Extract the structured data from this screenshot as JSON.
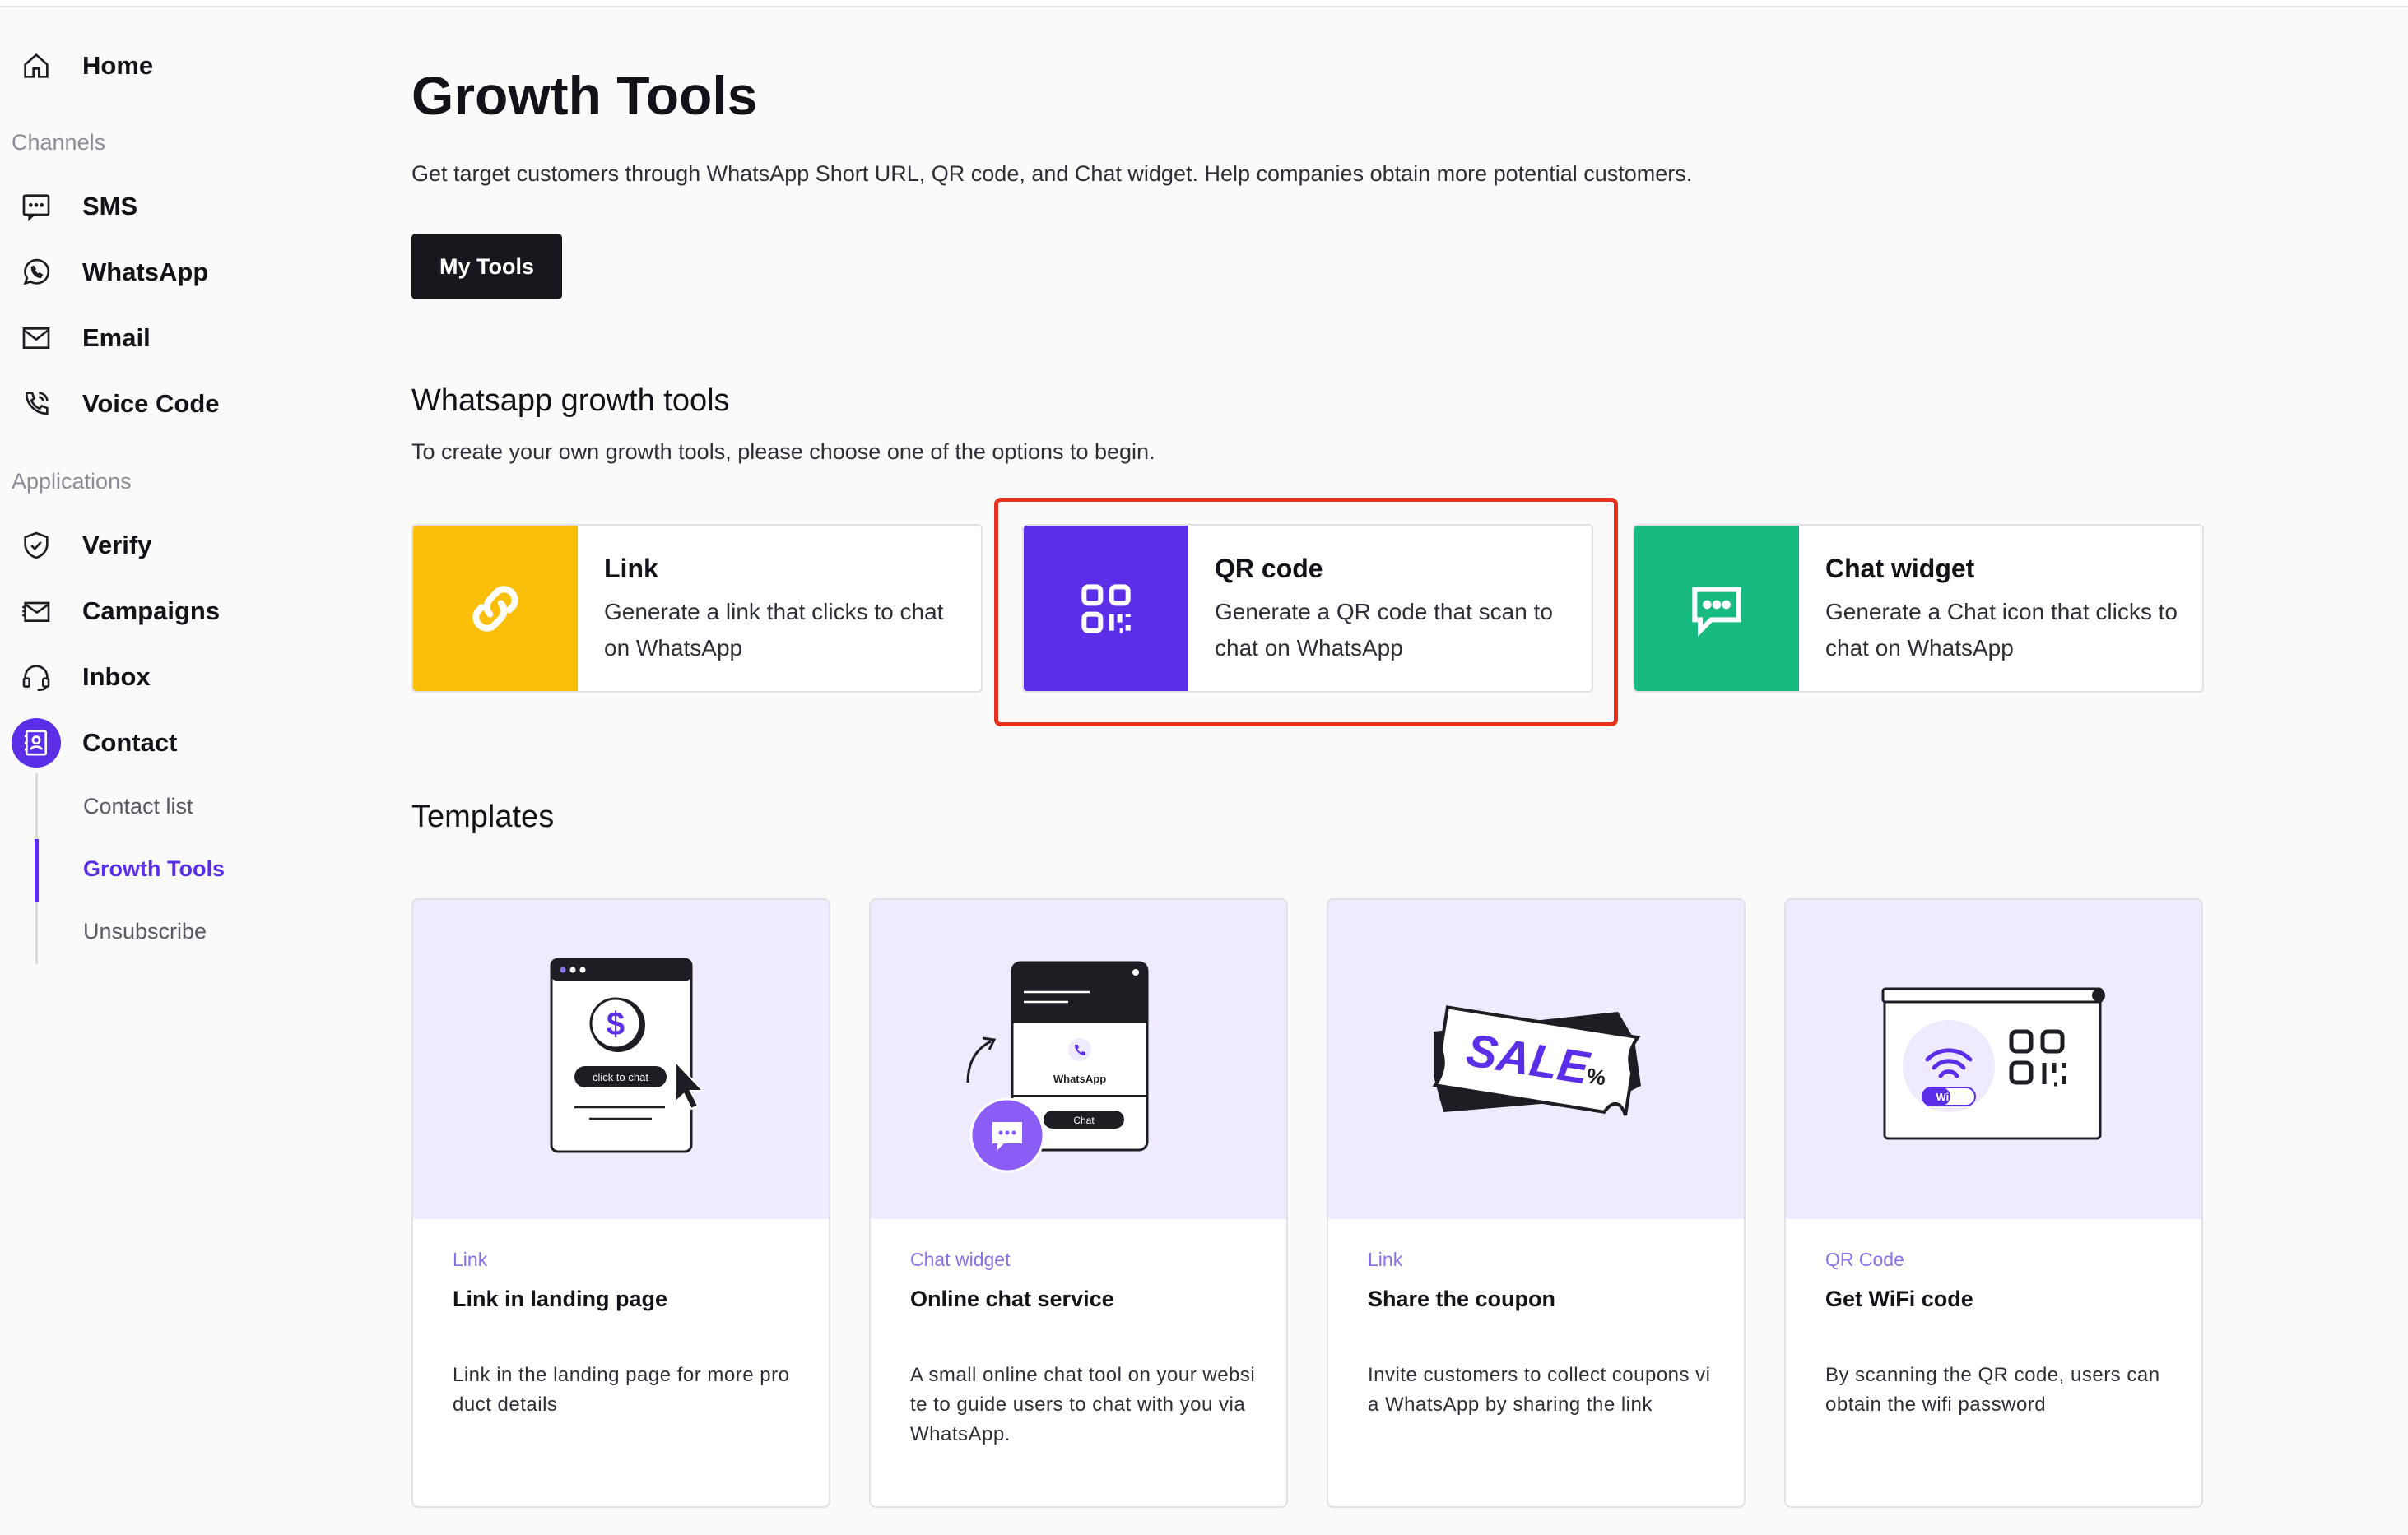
{
  "sidebar": {
    "home": "Home",
    "channels_label": "Channels",
    "sms": "SMS",
    "whatsapp": "WhatsApp",
    "email": "Email",
    "voice_code": "Voice Code",
    "applications_label": "Applications",
    "verify": "Verify",
    "campaigns": "Campaigns",
    "inbox": "Inbox",
    "contact": "Contact",
    "sub_items": [
      "Contact list",
      "Growth Tools",
      "Unsubscribe"
    ],
    "active_sub": "Growth Tools"
  },
  "main": {
    "title": "Growth Tools",
    "subtitle": "Get target customers through WhatsApp Short URL, QR code, and Chat widget. Help companies obtain more potential customers.",
    "my_tools_button": "My Tools",
    "whatsapp_section": {
      "title": "Whatsapp growth tools",
      "description": "To create your own growth tools, please choose one of the options to begin."
    },
    "tools": [
      {
        "title": "Link",
        "description": "Generate a link that clicks to chat on WhatsApp",
        "color": "#fbbf0a",
        "icon": "link-icon"
      },
      {
        "title": "QR code",
        "description": "Generate a QR code that scan to chat on WhatsApp",
        "color": "#5b2ee8",
        "icon": "qr-code-icon"
      },
      {
        "title": "Chat widget",
        "description": "Generate a Chat icon that clicks to chat on WhatsApp",
        "color": "#17bb80",
        "icon": "chat-bubble-icon"
      }
    ],
    "templates_title": "Templates",
    "templates": [
      {
        "category": "Link",
        "name": "Link in landing page",
        "description": "Link in the landing page for more product details",
        "art_text": "click to chat"
      },
      {
        "category": "Chat widget",
        "name": "Online chat service",
        "description": "A small online chat tool on your website to guide users to chat with you via WhatsApp.",
        "art_text": "WhatsApp",
        "art_button": "Chat"
      },
      {
        "category": "Link",
        "name": "Share the coupon",
        "description": "Invite customers to collect coupons via WhatsApp by sharing the link",
        "art_text": "SALE"
      },
      {
        "category": "QR Code",
        "name": "Get WiFi code",
        "description": "By scanning the QR code, users can obtain the wifi password",
        "art_text": "Wi Fi"
      }
    ]
  },
  "colors": {
    "accent": "#5b2ee8",
    "highlight": "#e8321f"
  }
}
